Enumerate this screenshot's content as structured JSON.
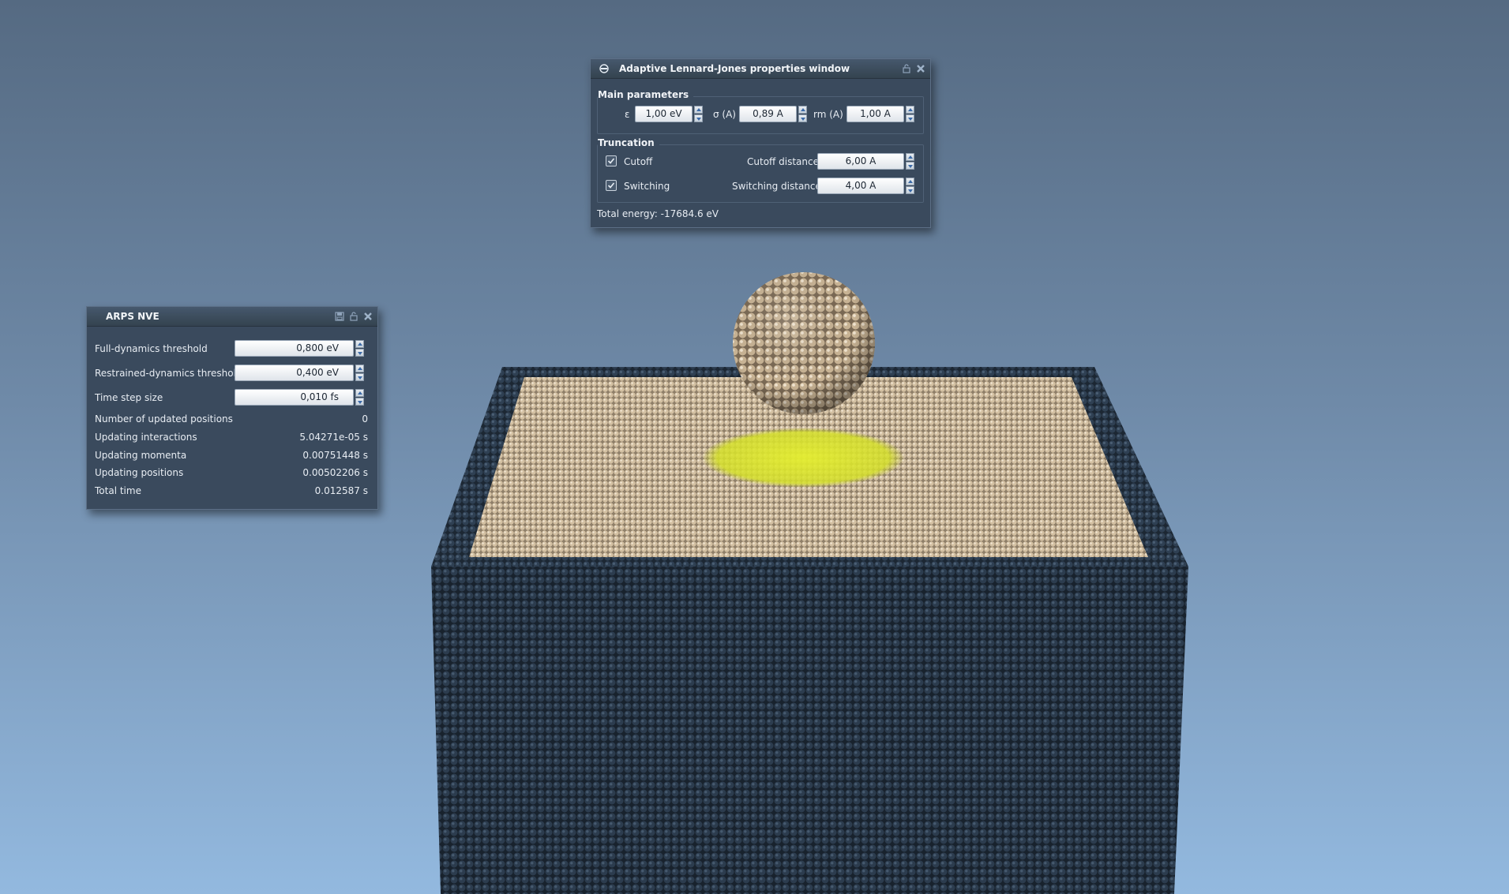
{
  "lj_window": {
    "title": "Adaptive Lennard-Jones properties window",
    "icons": [
      "molecule-app-icon",
      "lock-icon",
      "close-icon"
    ],
    "main_parameters": {
      "label": "Main parameters",
      "epsilon_label": "ε",
      "epsilon_value": "1,00 eV",
      "sigma_label": "σ (A)",
      "sigma_value": "0,89 A",
      "rm_label": "rm (A)",
      "rm_value": "1,00 A"
    },
    "truncation": {
      "label": "Truncation",
      "cutoff_label": "Cutoff",
      "cutoff_checked": true,
      "cutoff_distance_label": "Cutoff distance",
      "cutoff_distance_value": "6,00 A",
      "switching_label": "Switching",
      "switching_checked": true,
      "switching_distance_label": "Switching distance",
      "switching_distance_value": "4,00 A"
    },
    "total_energy": "Total energy: -17684.6 eV"
  },
  "arps_window": {
    "title": "ARPS NVE",
    "icons": [
      "save-icon",
      "lock-icon",
      "close-icon"
    ],
    "full_dynamics_label": "Full-dynamics threshold",
    "full_dynamics_value": "0,800 eV",
    "restrained_label": "Restrained-dynamics threshold",
    "restrained_value": "0,400 eV",
    "timestep_label": "Time step size",
    "timestep_value": "0,010 fs",
    "stats": [
      {
        "label": "Number of updated positions",
        "value": "0"
      },
      {
        "label": "Updating interactions",
        "value": "5.04271e-05 s"
      },
      {
        "label": "Updating momenta",
        "value": "0.00751448 s"
      },
      {
        "label": "Updating positions",
        "value": "0.00502206 s"
      },
      {
        "label": "Total time",
        "value": "0.012587 s"
      }
    ]
  },
  "scene": {
    "substrate_color": "#2b3a4b",
    "surface_color": "#d8c6a8",
    "cluster_color": "#cdb89a",
    "highlight_color": "#d9e62a"
  }
}
